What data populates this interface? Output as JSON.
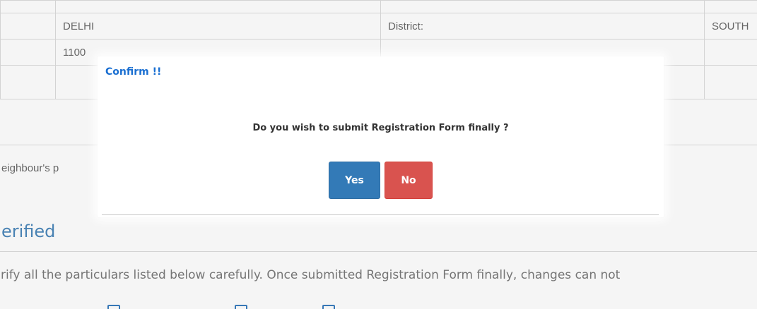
{
  "background": {
    "table_rows": [
      [
        "",
        "",
        "",
        ""
      ],
      [
        "",
        "DELHI",
        "District:",
        "SOUTH"
      ],
      [
        "",
        "1100",
        "",
        ""
      ],
      [
        "",
        "",
        "",
        ""
      ]
    ],
    "neighbour_text": "eighbour's p",
    "section_heading": "erified",
    "verify_instruction": "rify all the particulars listed below carefully. Once submitted Registration Form finally, changes can not"
  },
  "dialog": {
    "title": "Confirm !!",
    "message": "Do you wish to submit Registration Form finally ?",
    "yes_label": "Yes",
    "no_label": "No"
  },
  "colors": {
    "title": "#1a6fd1",
    "yes_button": "#337ab7",
    "no_button": "#d9534f",
    "heading": "#4c88bb"
  }
}
